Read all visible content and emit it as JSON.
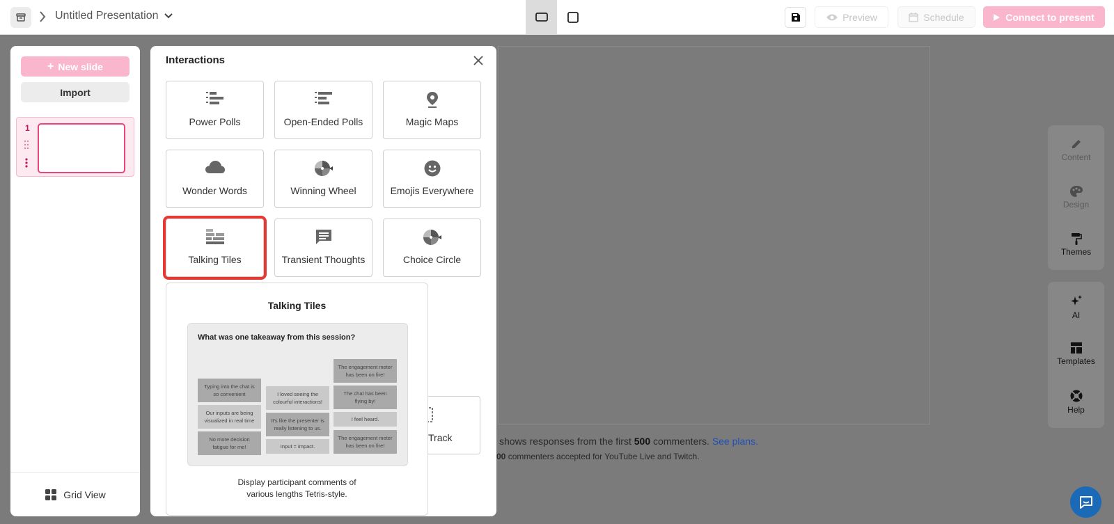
{
  "topbar": {
    "title": "Untitled Presentation",
    "preview_label": "Preview",
    "schedule_label": "Schedule",
    "present_label": "Connect to present"
  },
  "left_panel": {
    "new_slide_label": "New slide",
    "import_label": "Import",
    "slide_number": "1",
    "grid_view_label": "Grid View"
  },
  "modal": {
    "title": "Interactions",
    "tiles": [
      {
        "label": "Power Polls",
        "icon": "bar-list-icon"
      },
      {
        "label": "Open-Ended Polls",
        "icon": "numbered-list-icon"
      },
      {
        "label": "Magic Maps",
        "icon": "map-pin-icon"
      },
      {
        "label": "Wonder Words",
        "icon": "cloud-icon"
      },
      {
        "label": "Winning Wheel",
        "icon": "wheel-icon"
      },
      {
        "label": "Emojis Everywhere",
        "icon": "smiley-icon"
      },
      {
        "label": "Talking Tiles",
        "icon": "tiles-icon"
      },
      {
        "label": "Transient Thoughts",
        "icon": "chat-lines-icon"
      },
      {
        "label": "Choice Circle",
        "icon": "wheel-icon"
      }
    ],
    "partial_tile_label": "Track"
  },
  "tooltip": {
    "title": "Talking Tiles",
    "question": "What was one takeaway from this session?",
    "tiles": [
      "Typing into the chat is so convenient",
      "Our inputs are being visualized in real time",
      "No more decision fatigue for me!",
      "I loved seeing the colourful interactions!",
      "It's like the presenter is really listening to us.",
      "Input = impact.",
      "The engagement meter has been on fire!",
      "The chat has been flying by!",
      "I feel heard.",
      "The engagement meter has been on fire!"
    ],
    "description_line1": "Display participant comments of",
    "description_line2": "various lengths Tetris-style."
  },
  "canvas": {
    "limit_prefix": "shows responses from the first",
    "limit_count": "500",
    "limit_suffix": "commenters.",
    "limit_link": "See plans.",
    "limit_sub_count": "00",
    "limit_sub_text": "commenters accepted for YouTube Live and Twitch."
  },
  "right_rail": {
    "content_label": "Content",
    "design_label": "Design",
    "themes_label": "Themes",
    "ai_label": "AI",
    "templates_label": "Templates",
    "help_label": "Help"
  },
  "colors": {
    "brand_pink": "#f9b6cd",
    "slide_border": "#e8457f",
    "annotation_red": "#e53935",
    "link_blue": "#1e4fb8"
  }
}
